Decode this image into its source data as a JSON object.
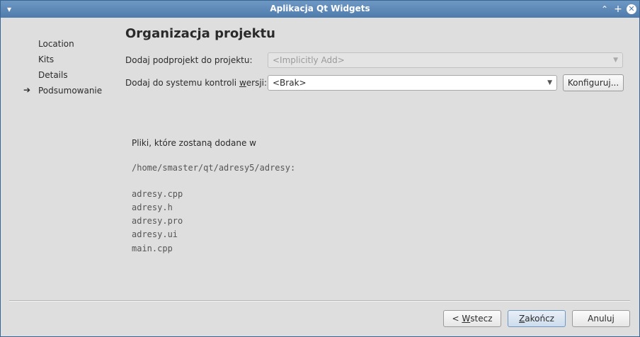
{
  "window": {
    "title": "Aplikacja Qt Widgets"
  },
  "titlebar_icons": {
    "menu": "chevron-down-icon",
    "shade": "chevron-up-icon",
    "maximize": "plus-icon",
    "close": "close-icon"
  },
  "sidebar": {
    "items": [
      {
        "label": "Location"
      },
      {
        "label": "Kits"
      },
      {
        "label": "Details"
      },
      {
        "label": "Podsumowanie"
      }
    ],
    "current_marker_icon": "arrow-right-icon"
  },
  "main": {
    "title": "Organizacja projektu",
    "subproject": {
      "label": "Dodaj podprojekt do projektu:",
      "value": "<Implicitly Add>"
    },
    "vcs": {
      "label_prefix": "Dodaj do systemu kontroli ",
      "label_underlined": "w",
      "label_suffix": "ersji:",
      "value": "<Brak>",
      "configure_button": "Konfiguruj..."
    },
    "files_intro": "Pliki, które zostaną dodane w",
    "path": "/home/smaster/qt/adresy5/adresy:",
    "files": [
      "adresy.cpp",
      "adresy.h",
      "adresy.pro",
      "adresy.ui",
      "main.cpp"
    ]
  },
  "buttons": {
    "back_prefix": "< ",
    "back_underlined": "W",
    "back_suffix": "stecz",
    "finish_underlined": "Z",
    "finish_suffix": "akończ",
    "cancel": "Anuluj"
  }
}
